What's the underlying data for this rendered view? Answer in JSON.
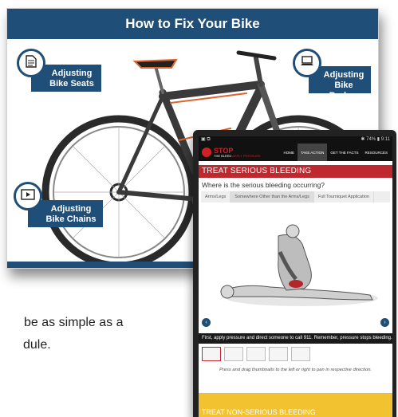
{
  "slide": {
    "title": "How to Fix Your Bike",
    "hotspots": [
      {
        "label": "Adjusting\nBike Seats",
        "icon": "document-icon"
      },
      {
        "label": "Adjusting\nBike Brakes",
        "icon": "laptop-icon"
      },
      {
        "label": "Adjusting\nBike Chains",
        "icon": "video-icon"
      }
    ]
  },
  "tablet": {
    "status_left": "▣ ⧉",
    "status_right": "✱ 74% ▮ 9:11",
    "logo": {
      "line1": "STOP",
      "line2": "THE BLEED",
      "line3": "APPLY PRESSURE"
    },
    "nav": [
      "HOME",
      "TAKE ACTION",
      "GET THE FACTS",
      "RESOURCES"
    ],
    "section_title": "TREAT SERIOUS BLEEDING",
    "question": "Where is the serious bleeding occurring?",
    "tabs": [
      "Arms/Legs",
      "Somewhere Other than the Arms/Legs",
      "Full Tourniquet Application"
    ],
    "caption": "First, apply pressure and direct someone to call 911. Remember, pressure stops bleeding.",
    "hint": "Press and drag thumbnails to the left or right to pan in respective direction.",
    "section2_title": "TREAT NON-SERIOUS BLEEDING"
  },
  "body": {
    "line1": "be as simple as a",
    "line2": "dule."
  },
  "colors": {
    "slide_blue": "#1f4e79",
    "stop_red": "#c0282f",
    "yellow": "#f2c230"
  }
}
